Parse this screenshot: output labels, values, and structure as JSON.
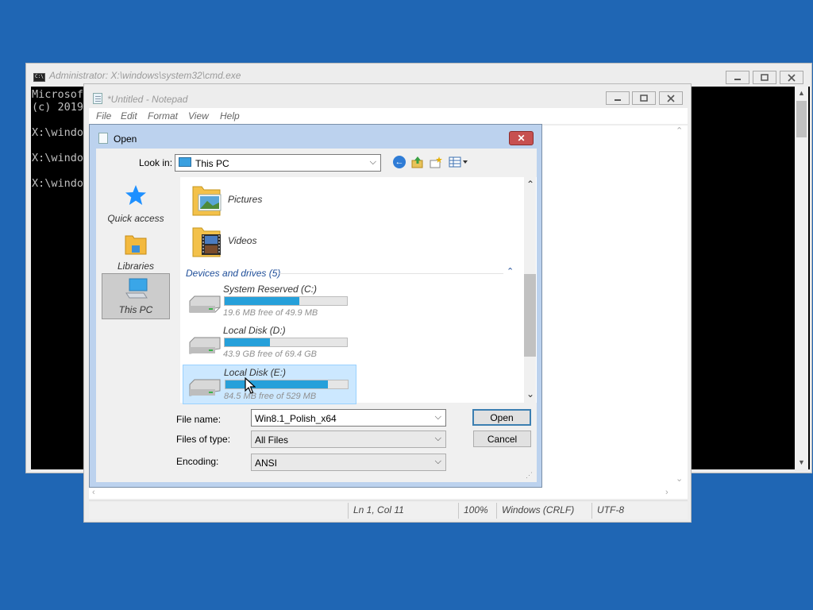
{
  "desktop": {
    "background": "#1f66b4"
  },
  "cmd_window": {
    "title": "Administrator: X:\\windows\\system32\\cmd.exe",
    "lines": [
      "Microsof",
      "(c) 2019",
      "X:\\windo",
      "X:\\windo",
      "X:\\windo"
    ]
  },
  "notepad": {
    "title": "*Untitled - Notepad",
    "menu": [
      "File",
      "Edit",
      "Format",
      "View",
      "Help"
    ],
    "status": {
      "position": "Ln 1, Col 11",
      "zoom": "100%",
      "line_endings": "Windows (CRLF)",
      "encoding": "UTF-8"
    }
  },
  "open_dialog": {
    "title": "Open",
    "look_in_label": "Look in:",
    "look_in_value": "This PC",
    "places": [
      {
        "label": "Quick access",
        "icon": "star-icon"
      },
      {
        "label": "Libraries",
        "icon": "libraries-icon"
      },
      {
        "label": "This PC",
        "icon": "computer-icon",
        "active": true
      }
    ],
    "folders": [
      {
        "name": "Pictures",
        "icon": "pictures-folder-icon"
      },
      {
        "name": "Videos",
        "icon": "videos-folder-icon"
      }
    ],
    "drives_header": "Devices and drives (5)",
    "drives": [
      {
        "name": "System Reserved (C:)",
        "free_text": "19.6 MB free of 49.9 MB",
        "used_fraction": 0.61
      },
      {
        "name": "Local Disk (D:)",
        "free_text": "43.9 GB free of 69.4 GB",
        "used_fraction": 0.37
      },
      {
        "name": "Local Disk (E:)",
        "free_text": "84.5 MB free of 529 MB",
        "used_fraction": 0.84,
        "selected": true
      }
    ],
    "file_name_label": "File name:",
    "file_name_value": "Win8.1_Polish_x64",
    "files_of_type_label": "Files of type:",
    "files_of_type_value": "All Files",
    "encoding_label": "Encoding:",
    "encoding_value": "ANSI",
    "open_label": "Open",
    "cancel_label": "Cancel"
  }
}
